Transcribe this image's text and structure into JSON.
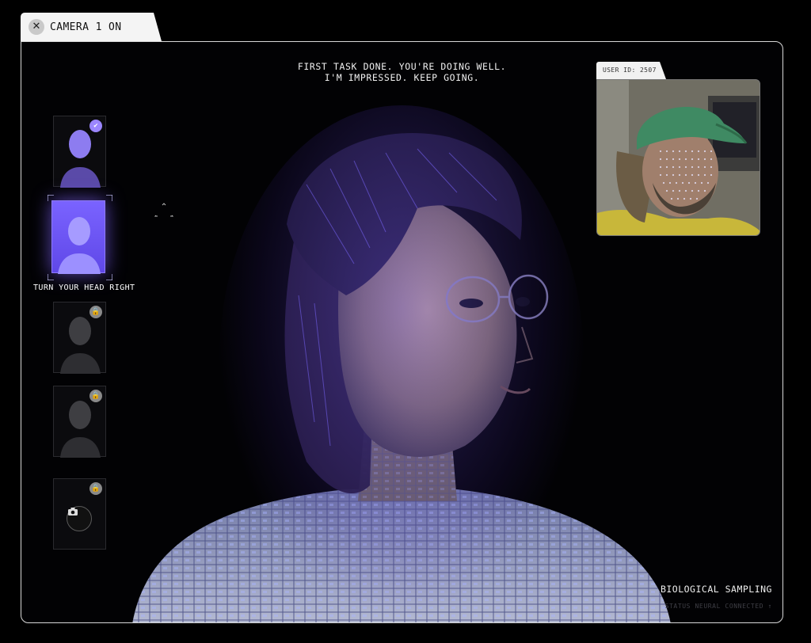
{
  "camera_tab": {
    "close_icon": "close-icon",
    "label": "CAMERA 1 ON"
  },
  "message": {
    "line1": "FIRST TASK DONE. YOU'RE DOING WELL.",
    "line2": "I'M IMPRESSED. KEEP GOING."
  },
  "steps": [
    {
      "state": "done",
      "badge_icon": "check-icon"
    },
    {
      "state": "active",
      "instruction": "TURN YOUR HEAD RIGHT"
    },
    {
      "state": "locked",
      "badge_icon": "lock-icon"
    },
    {
      "state": "locked",
      "badge_icon": "lock-icon"
    },
    {
      "state": "locked",
      "badge_icon": "lock-icon",
      "action_icon": "camera-icon"
    }
  ],
  "webcam": {
    "user_label": "USER ID: 2507"
  },
  "footer": {
    "title": "BIOLOGICAL SAMPLING",
    "status": "STATUS    NEURAL    CONNECTED    ↑"
  },
  "colors": {
    "accent": "#8f7bff",
    "glow": "#6a4cff",
    "frame": "#d8d8d8",
    "background": "#000000"
  }
}
